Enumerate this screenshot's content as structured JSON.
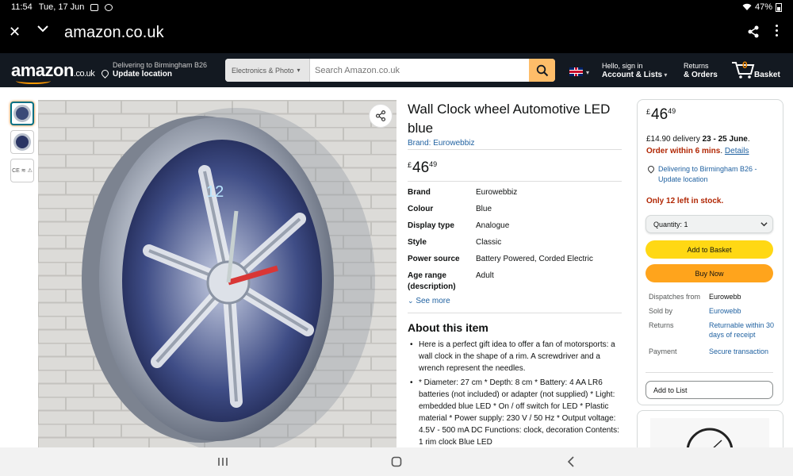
{
  "status_bar": {
    "time": "11:54",
    "date": "Tue, 17 Jun",
    "battery": "47%"
  },
  "browser": {
    "url": "amazon.co.uk",
    "icons": [
      "close-icon",
      "chevron-down-icon",
      "share-icon",
      "more-vert-icon"
    ]
  },
  "header": {
    "logo": "amazon",
    "logo_tld": ".co.uk",
    "deliver_line1": "Delivering to Birmingham B26",
    "deliver_line2": "Update location",
    "search_category": "Electronics & Photo",
    "search_placeholder": "Search Amazon.co.uk",
    "account_line1": "Hello, sign in",
    "account_line2": "Account & Lists",
    "returns_line1": "Returns",
    "returns_line2": "& Orders",
    "basket_count": "0",
    "basket_label": "Basket",
    "brand_color": "#131921",
    "accent_color": "#febd69"
  },
  "thumbnails": [
    "clock-front",
    "clock-side",
    "CE label"
  ],
  "product": {
    "title": "Wall Clock wheel Automotive LED blue",
    "brand_link": "Brand: Eurowebbiz",
    "price_symbol": "£",
    "price_whole": "46",
    "price_fraction": "49",
    "specs": [
      {
        "k": "Brand",
        "v": "Eurowebbiz"
      },
      {
        "k": "Colour",
        "v": "Blue"
      },
      {
        "k": "Display type",
        "v": "Analogue"
      },
      {
        "k": "Style",
        "v": "Classic"
      },
      {
        "k": "Power source",
        "v": "Battery Powered, Corded Electric"
      },
      {
        "k": "Age range (description)",
        "v": "Adult"
      }
    ],
    "see_more": "See more",
    "about_title": "About this item",
    "bullets": [
      "Here is a perfect gift idea to offer a fan of motorsports: a wall clock in the shape of a rim. A screwdriver and a wrench represent the needles.",
      "* Diameter: 27 cm * Depth: 8 cm * Battery: 4 AA LR6 batteries (not included) or adapter (not supplied) * Light: embedded blue LED * On / off switch for LED * Plastic material * Power supply: 230 V / 50 Hz * Output voltage: 4.5V - 500 mA DC Functions: clock, decoration Contents: 1 rim clock Blue LED"
    ]
  },
  "buybox": {
    "price_symbol": "£",
    "price_whole": "46",
    "price_fraction": "49",
    "delivery_text": "£14.90 delivery ",
    "delivery_dates": "23 - 25 June",
    "order_within": "Order within 6 mins",
    "details_link": "Details",
    "location": "Delivering to Birmingham B26 - Update location",
    "stock": "Only 12 left in stock.",
    "quantity": "Quantity: 1",
    "add_to_basket": "Add to Basket",
    "buy_now": "Buy Now",
    "meta": [
      {
        "k": "Dispatches from",
        "v": "Eurowebb",
        "link": false
      },
      {
        "k": "Sold by",
        "v": "Eurowebb",
        "link": true
      },
      {
        "k": "Returns",
        "v": "Returnable within 30 days of receipt",
        "link": true
      },
      {
        "k": "Payment",
        "v": "Secure transaction",
        "link": true
      }
    ],
    "add_to_list": "Add to List",
    "button_yellow": "#ffd814",
    "button_orange": "#ffa41c"
  }
}
